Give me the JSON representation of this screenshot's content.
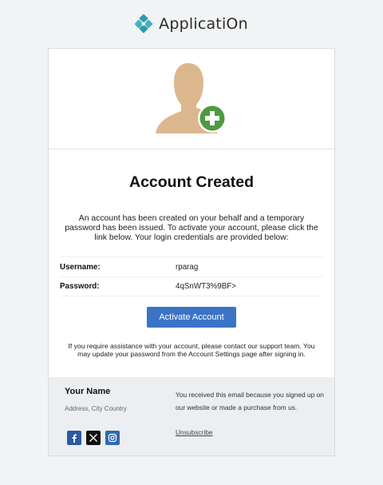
{
  "header": {
    "brand": "ApplicatiOn",
    "brand_color": "#2a9bb0"
  },
  "hero": {
    "icon": "add-user-icon",
    "avatar_color": "#dcb78e",
    "plus_color": "#4f9a3f"
  },
  "content": {
    "title": "Account Created",
    "intro": "An account has been created on your behalf and a temporary password has been issued. To activate your account, please click the link below. Your login credentials are provided below:",
    "credentials": [
      {
        "label": "Username:",
        "value": "rparag"
      },
      {
        "label": "Password:",
        "value": "4qSnWT3%9BF>"
      }
    ],
    "activate_label": "Activate Account",
    "button_color": "#3b74c6",
    "help": "If you require assistance with your account, please contact our support team. You may update your password from the Account Settings page after signing in."
  },
  "footer": {
    "name": "Your Name",
    "address": "Address, City Country",
    "notice": "You received this email because you signed up on our website or made a purchase from us.",
    "unsubscribe": "Unsubscribe",
    "socials": [
      {
        "icon": "facebook-icon"
      },
      {
        "icon": "x-icon"
      },
      {
        "icon": "instagram-icon"
      }
    ]
  }
}
